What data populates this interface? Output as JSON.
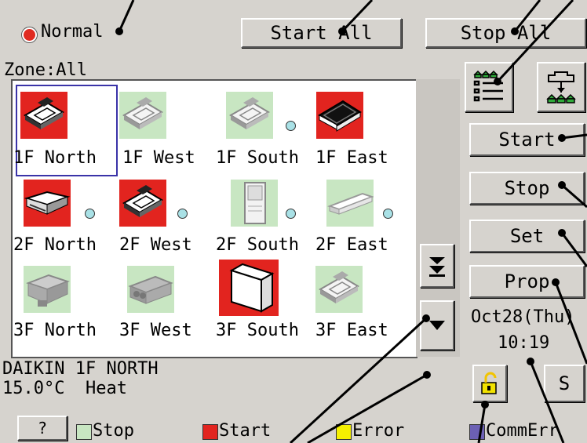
{
  "status": {
    "label": "Normal",
    "color": "#e02a20"
  },
  "header": {
    "start_all": "Start All",
    "stop_all": "Stop All",
    "zone_label": "Zone:All"
  },
  "zones": [
    {
      "name": "1F North",
      "state": "start",
      "unit": "cassette",
      "selected": true
    },
    {
      "name": "1F West",
      "state": "stop",
      "unit": "cassette"
    },
    {
      "name": "1F South",
      "state": "stop",
      "unit": "cassette"
    },
    {
      "name": "1F East",
      "state": "start",
      "unit": "cassette-dark"
    },
    {
      "name": "2F North",
      "state": "start",
      "unit": "ceiling-suspended"
    },
    {
      "name": "2F West",
      "state": "start",
      "unit": "cassette"
    },
    {
      "name": "2F South",
      "state": "stop",
      "unit": "floor-standing"
    },
    {
      "name": "2F East",
      "state": "stop",
      "unit": "wall-mounted"
    },
    {
      "name": "3F North",
      "state": "stop",
      "unit": "duct"
    },
    {
      "name": "3F West",
      "state": "stop",
      "unit": "heat-exchanger"
    },
    {
      "name": "3F South",
      "state": "start",
      "unit": "floor-console"
    },
    {
      "name": "3F East",
      "state": "stop",
      "unit": "cassette"
    }
  ],
  "side": {
    "start": "Start",
    "stop": "Stop",
    "set": "Set",
    "prop": "Prop"
  },
  "clock": {
    "date": "Oct28(Thu)",
    "time": "10:19"
  },
  "info": {
    "line1": "DAIKIN 1F NORTH",
    "line2": "15.0°C  Heat"
  },
  "bottom": {
    "help": "?",
    "s_button": "S"
  },
  "legend": [
    {
      "label": "Stop",
      "color": "#c8e6c2"
    },
    {
      "label": "Start",
      "color": "#e2241f"
    },
    {
      "label": "Error",
      "color": "#f5f000"
    },
    {
      "label": "CommErr",
      "color": "#6c60b4"
    }
  ],
  "colors": {
    "panel": "#d6d3ce",
    "start": "#e2241f",
    "stop": "#c8e6c2",
    "indicator": "#a9e1e6"
  }
}
